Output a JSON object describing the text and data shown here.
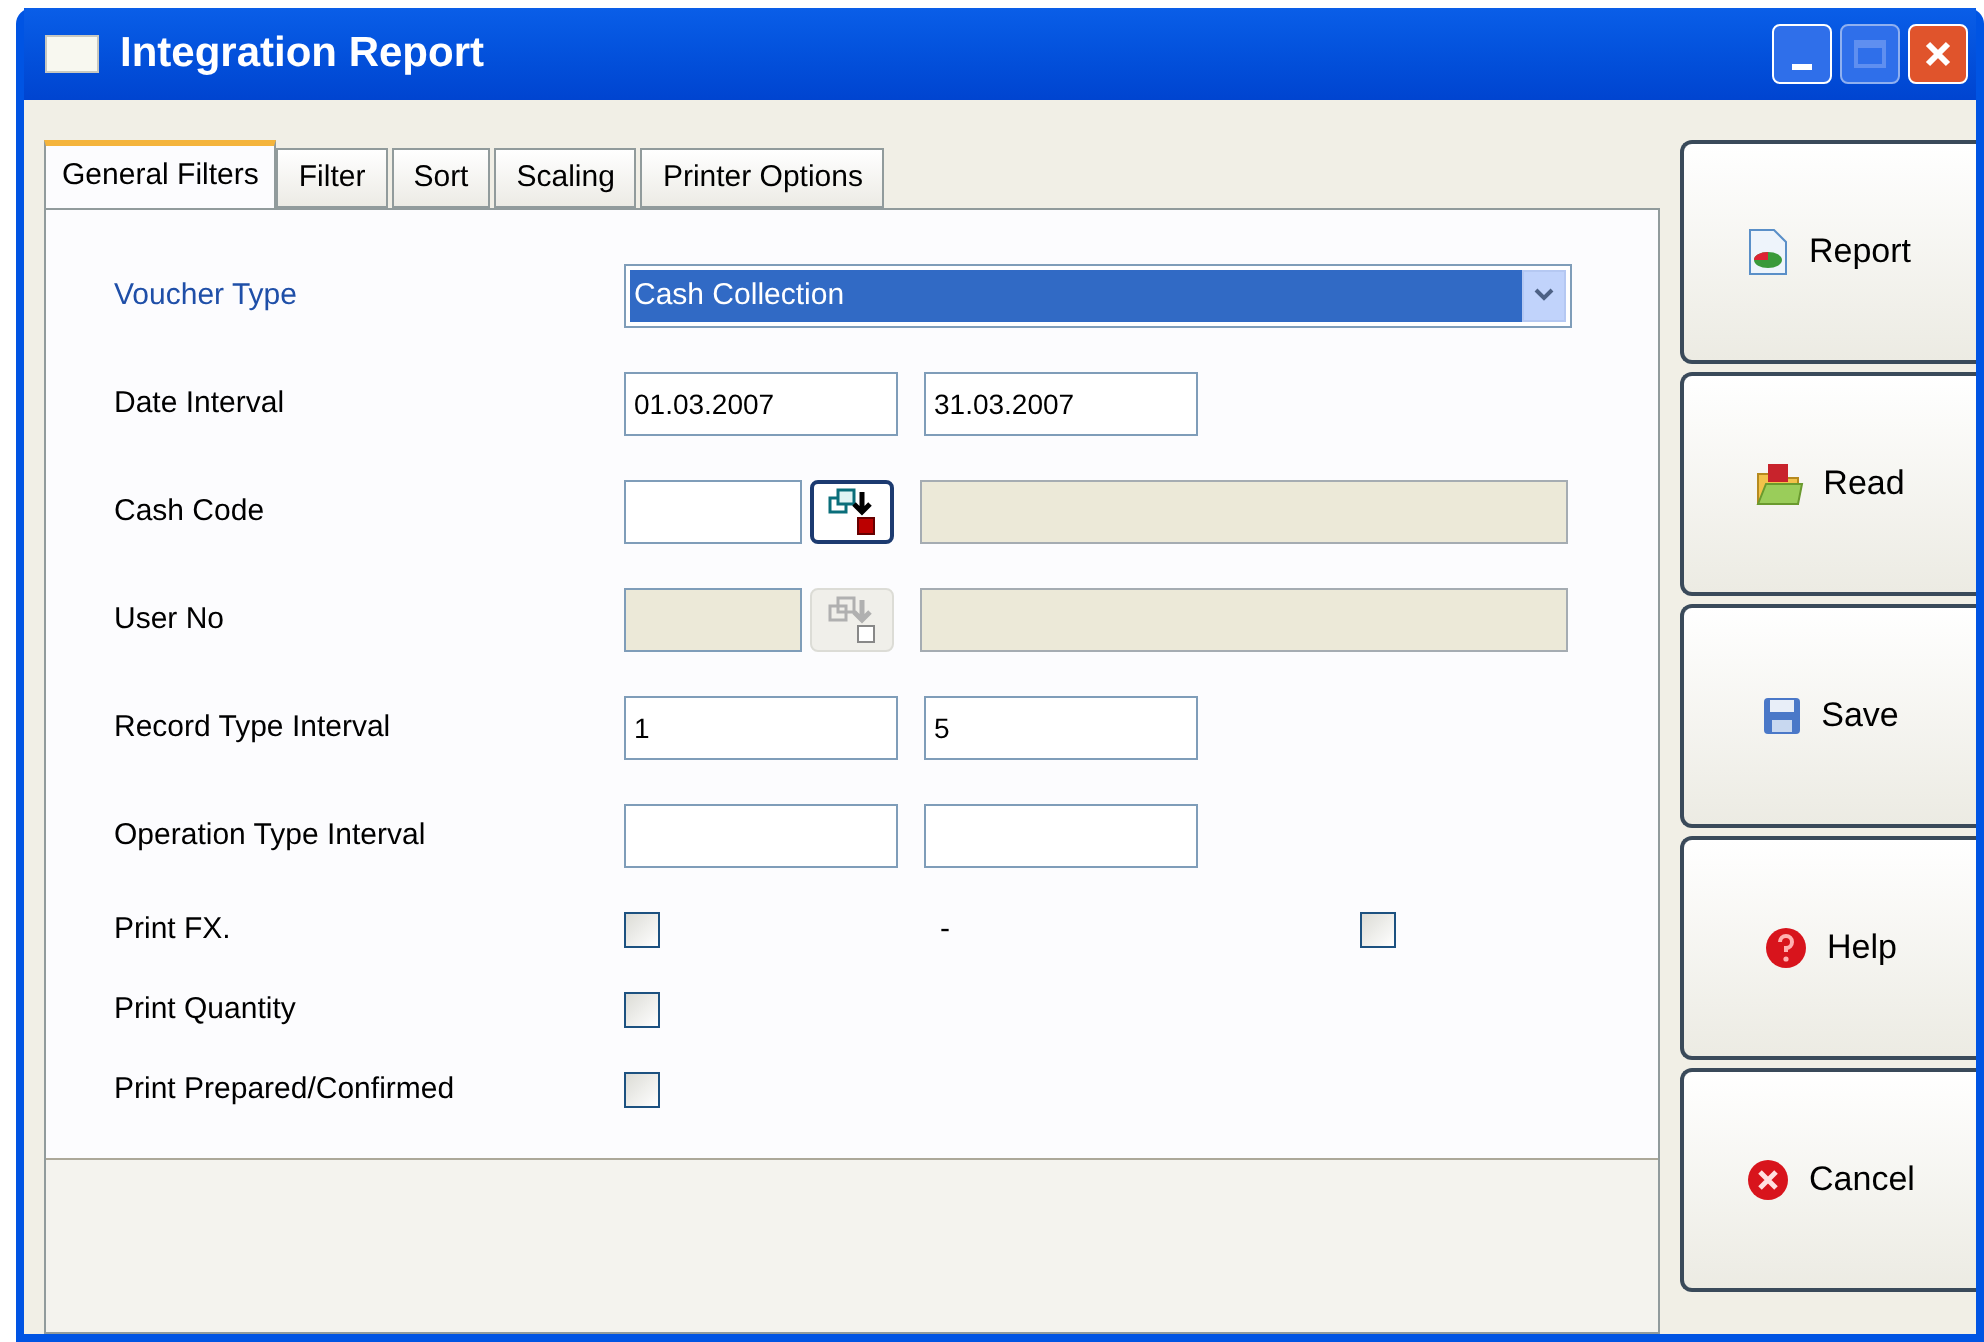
{
  "window": {
    "title": "Integration Report"
  },
  "tabs": [
    {
      "label": "General Filters",
      "selected": true
    },
    {
      "label": "Filter",
      "selected": false
    },
    {
      "label": "Sort",
      "selected": false
    },
    {
      "label": "Scaling",
      "selected": false
    },
    {
      "label": "Printer Options",
      "selected": false
    }
  ],
  "fields": [
    {
      "kind": "dropdown",
      "label": "Voucher Type",
      "value": "Cash Collection",
      "highlighted": true
    },
    {
      "kind": "range",
      "label": "Date Interval",
      "from": "01.03.2007",
      "to": "31.03.2007"
    },
    {
      "kind": "lookup",
      "label": "Cash Code",
      "disabled": false
    },
    {
      "kind": "lookup",
      "label": "User No",
      "disabled": true
    },
    {
      "kind": "range",
      "label": "Record Type Interval",
      "from": "1",
      "to": "5"
    },
    {
      "kind": "range",
      "label": "Operation Type Interval"
    },
    {
      "kind": "check_pair",
      "label": "Print FX.",
      "checked": false,
      "separator": "-",
      "checked_2": false
    },
    {
      "kind": "check",
      "label": "Print Quantity",
      "checked": false
    },
    {
      "kind": "check",
      "label": "Print Prepared/Confirmed",
      "checked": false
    }
  ],
  "buttons": [
    {
      "kind": "report",
      "label": "Report"
    },
    {
      "kind": "read",
      "label": "Read"
    },
    {
      "kind": "save",
      "label": "Save"
    },
    {
      "kind": "help",
      "label": "Help"
    },
    {
      "kind": "cancel",
      "label": "Cancel"
    }
  ]
}
